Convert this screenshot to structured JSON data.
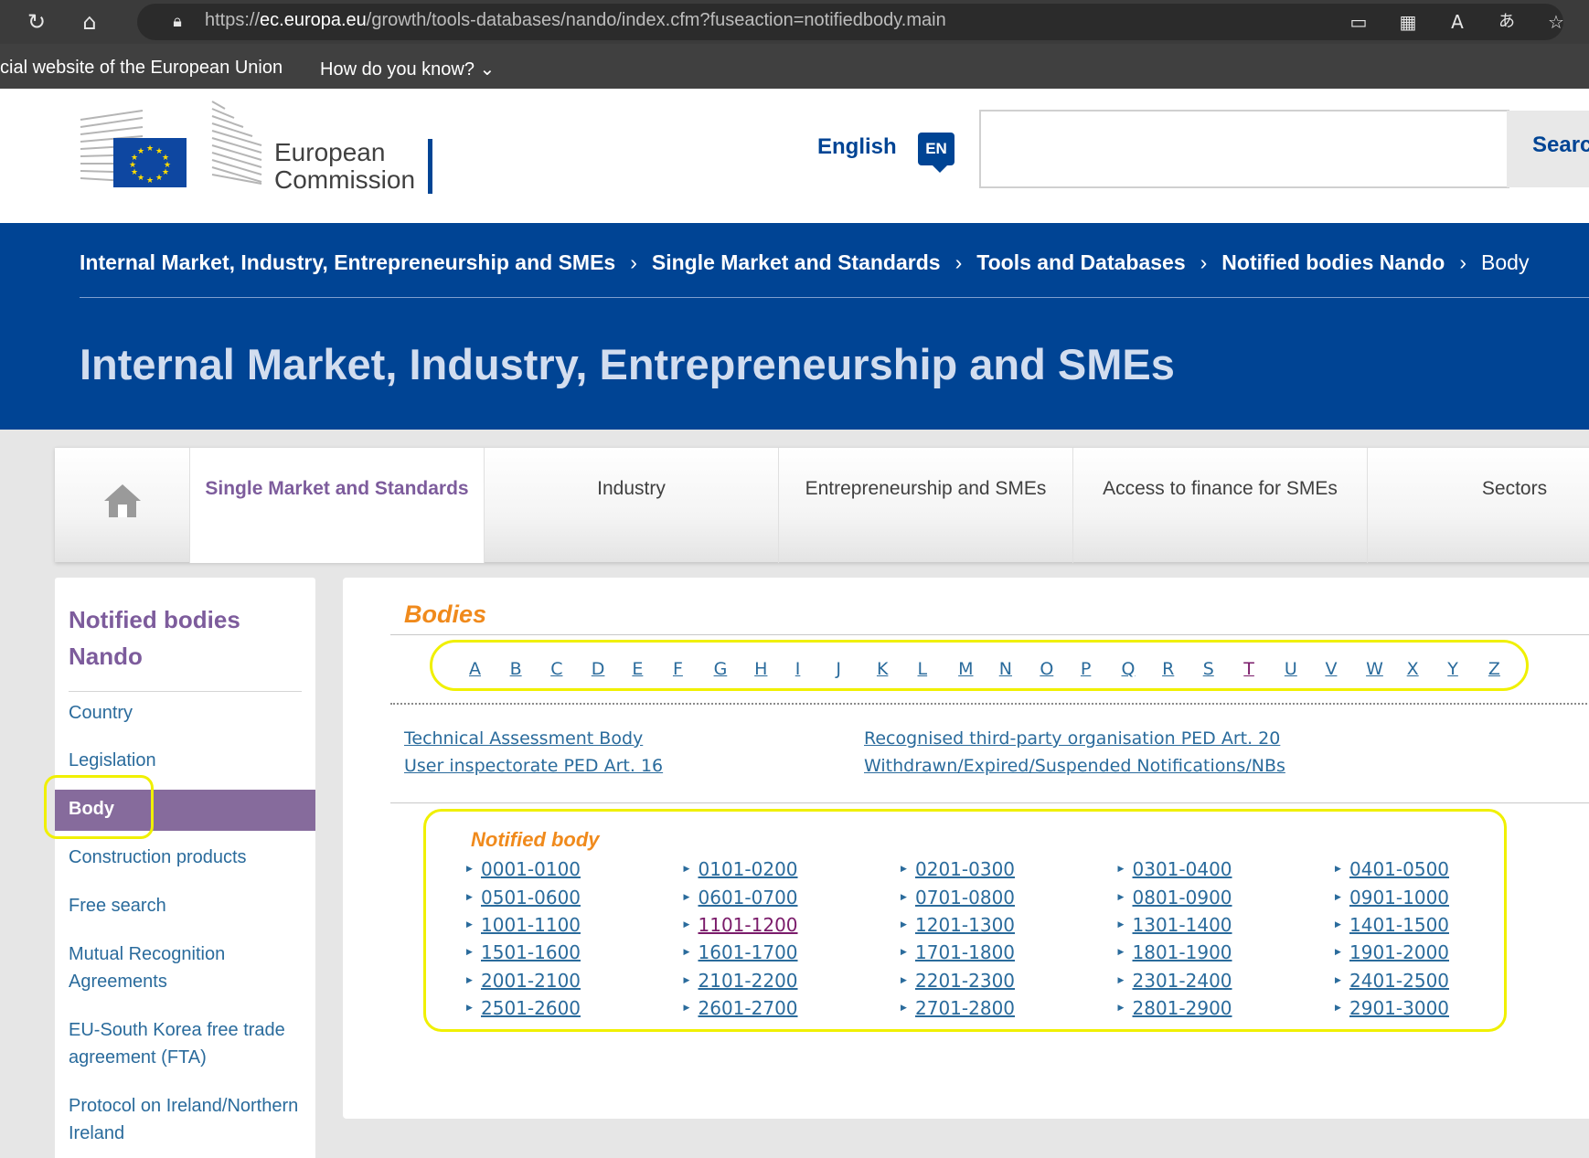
{
  "browser": {
    "url_prefix": "https://",
    "url_domain": "ec.europa.eu",
    "url_path": "/growth/tools-databases/nando/index.cfm?fuseaction=notifiedbody.main"
  },
  "eu_bar": {
    "official_text": "cial website of the European Union",
    "how_know": "How do you know? ⌄"
  },
  "header": {
    "logo_text_line1": "European",
    "logo_text_line2": "Commission",
    "language": "English",
    "language_code": "EN",
    "search_button": "Search"
  },
  "breadcrumb": {
    "items": [
      "Internal Market, Industry, Entrepreneurship and SMEs",
      "Single Market and Standards",
      "Tools and Databases",
      "Notified bodies Nando"
    ],
    "current": "Body",
    "separator": "›"
  },
  "page_title": "Internal Market, Industry, Entrepreneurship and SMEs",
  "nav": {
    "items": [
      "Single Market and Standards",
      "Industry",
      "Entrepreneurship and SMEs",
      "Access to finance for SMEs",
      "Sectors"
    ],
    "active_color": "#7d5c9c"
  },
  "sidebar": {
    "title": "Notified bodies Nando",
    "items": [
      "Country",
      "Legislation",
      "Body",
      "Construction products",
      "Free search",
      "Mutual Recognition Agreements",
      "EU-South Korea free trade agreement (FTA)",
      "Protocol on Ireland/Northern Ireland"
    ],
    "active_item": "Body"
  },
  "main": {
    "title": "Bodies",
    "letters": [
      "A",
      "B",
      "C",
      "D",
      "E",
      "F",
      "G",
      "H",
      "I",
      "J",
      "K",
      "L",
      "M",
      "N",
      "O",
      "P",
      "Q",
      "R",
      "S",
      "T",
      "U",
      "V",
      "W",
      "X",
      "Y",
      "Z"
    ],
    "visited_letter": "T",
    "categories": [
      "Technical Assessment Body",
      "Recognised third-party organisation PED Art. 20",
      "User inspectorate PED Art. 16",
      "Withdrawn/Expired/Suspended Notifications/NBs"
    ],
    "notified_title": "Notified body",
    "ranges": [
      "0001-0100",
      "0101-0200",
      "0201-0300",
      "0301-0400",
      "0401-0500",
      "0501-0600",
      "0601-0700",
      "0701-0800",
      "0801-0900",
      "0901-1000",
      "1001-1100",
      "1101-1200",
      "1201-1300",
      "1301-1400",
      "1401-1500",
      "1501-1600",
      "1601-1700",
      "1701-1800",
      "1801-1900",
      "1901-2000",
      "2001-2100",
      "2101-2200",
      "2201-2300",
      "2301-2400",
      "2401-2500",
      "2501-2600",
      "2601-2700",
      "2701-2800",
      "2801-2900",
      "2901-3000"
    ],
    "visited_range": "1101-1200"
  },
  "colors": {
    "eu_blue": "#004494",
    "purple": "#7d5c9c",
    "orange": "#f08a1c",
    "link": "#2a6b9c",
    "highlight": "#f0f000"
  }
}
